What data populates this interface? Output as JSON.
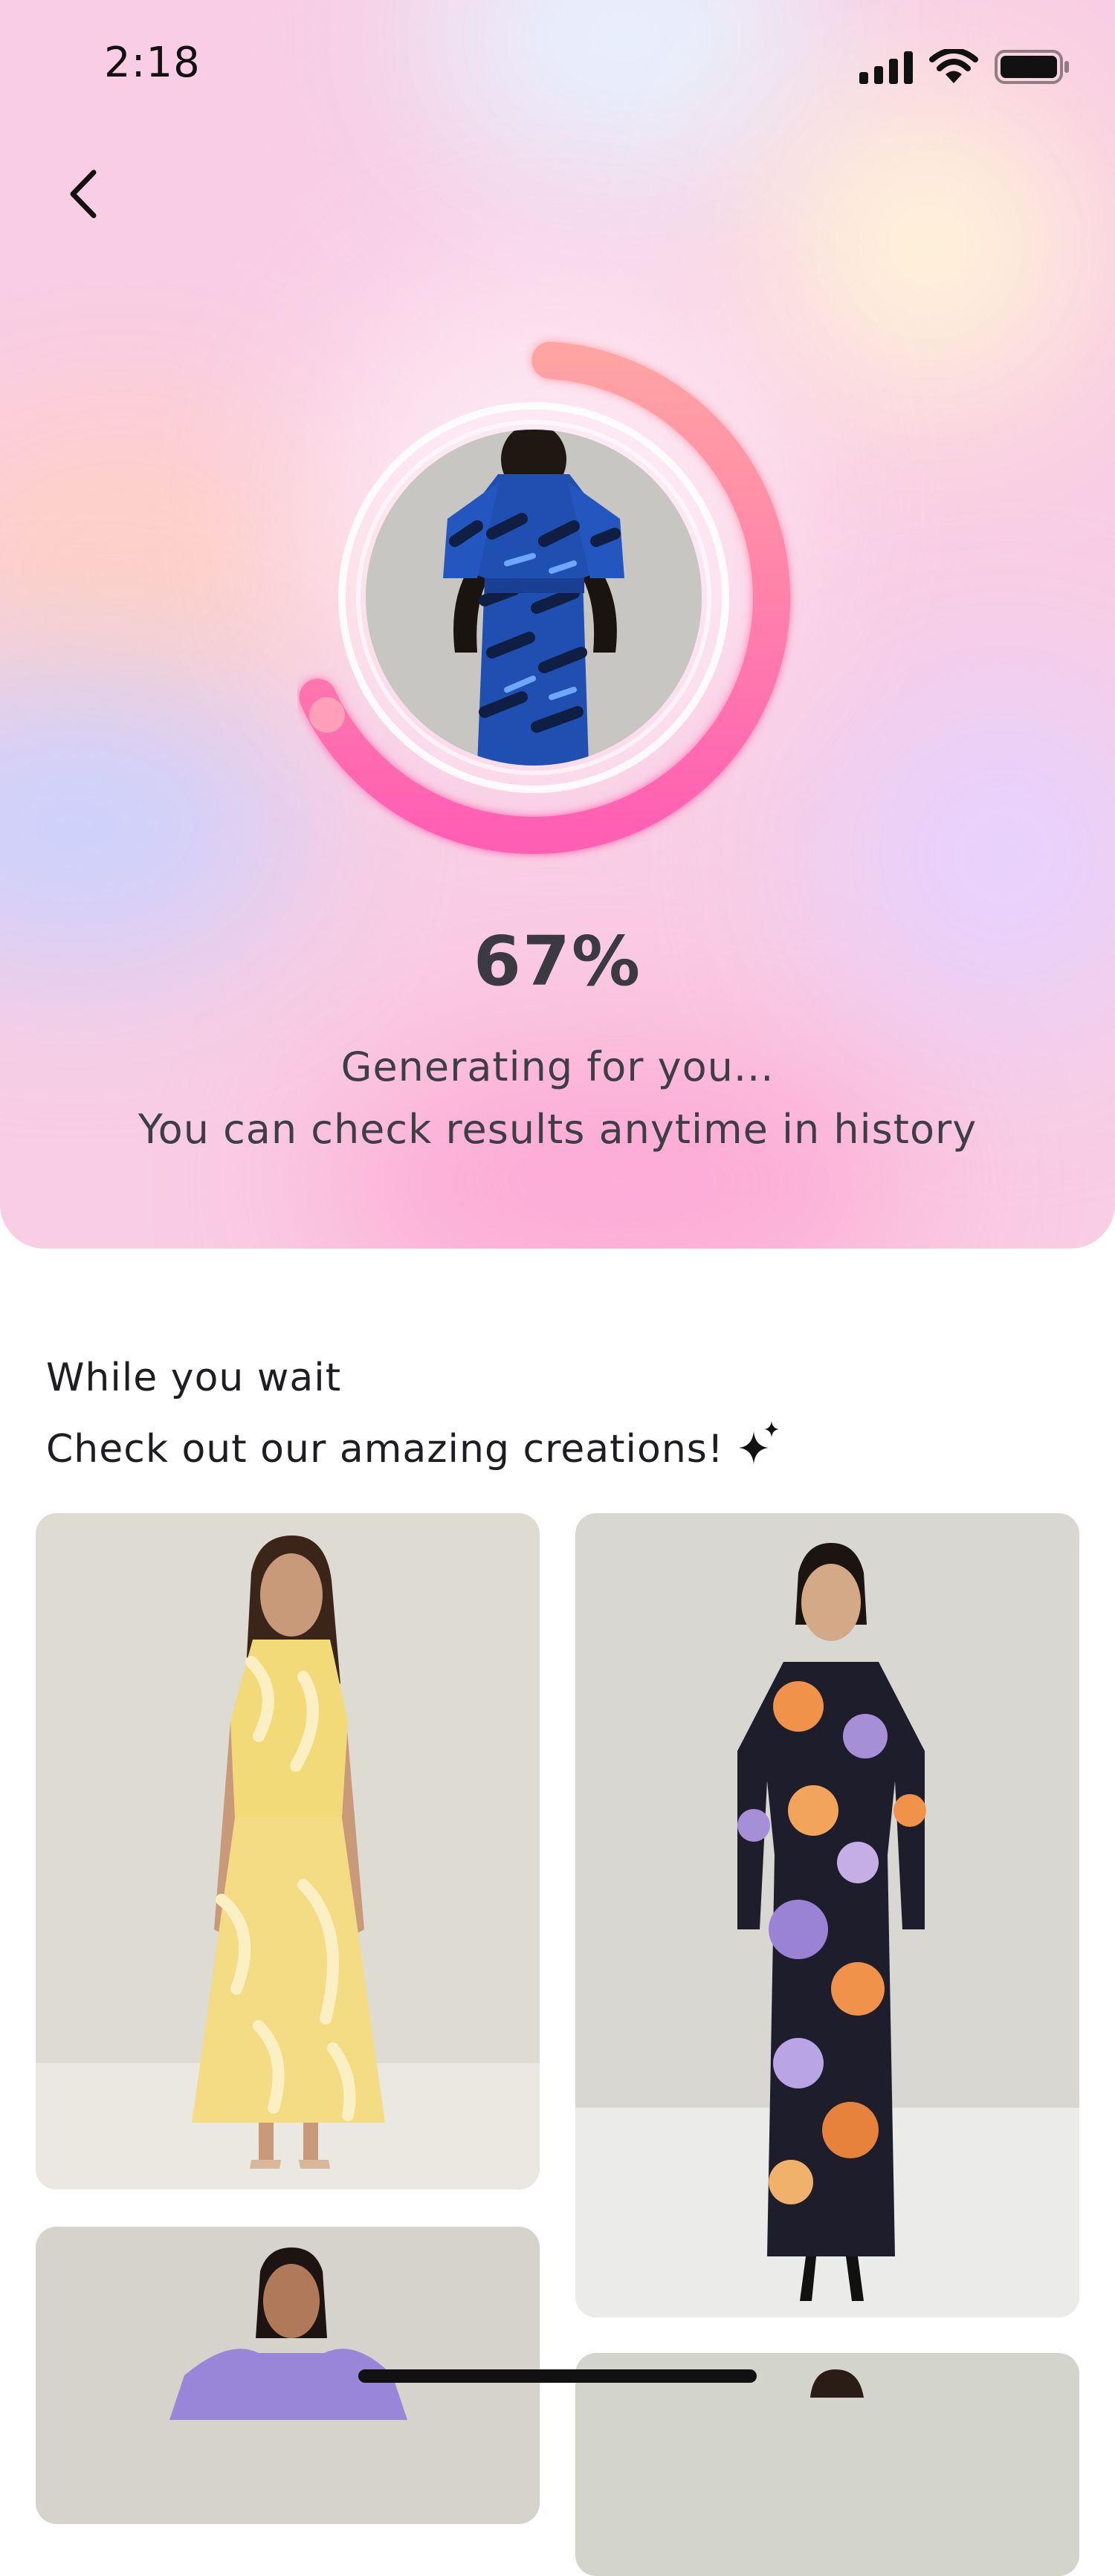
{
  "status_bar": {
    "time": "2:18"
  },
  "progress": {
    "percent_label": "67%",
    "value": 0.67
  },
  "generating": {
    "line1": "Generating for you...",
    "line2": "You can check results anytime in history"
  },
  "wait_section": {
    "line1": "While you wait",
    "line2": "Check out our amazing creations!"
  },
  "colors": {
    "ring_start": "#ffa3a3",
    "ring_end": "#ff5fb3",
    "hero_base": "#f9cde3",
    "text_dark": "#2f2f35"
  },
  "icons": {
    "back": "chevron-left-icon",
    "sparkle": "sparkle-icon",
    "signal": "cellular-signal-icon",
    "wifi": "wifi-icon",
    "battery": "battery-icon"
  },
  "gallery": [
    {
      "id": "yellow-set",
      "palette": "yellow"
    },
    {
      "id": "floral-navy-dress",
      "palette": "navy-floral"
    },
    {
      "id": "purple-top",
      "palette": "purple"
    },
    {
      "id": "fourth-item",
      "palette": "neutral"
    }
  ]
}
